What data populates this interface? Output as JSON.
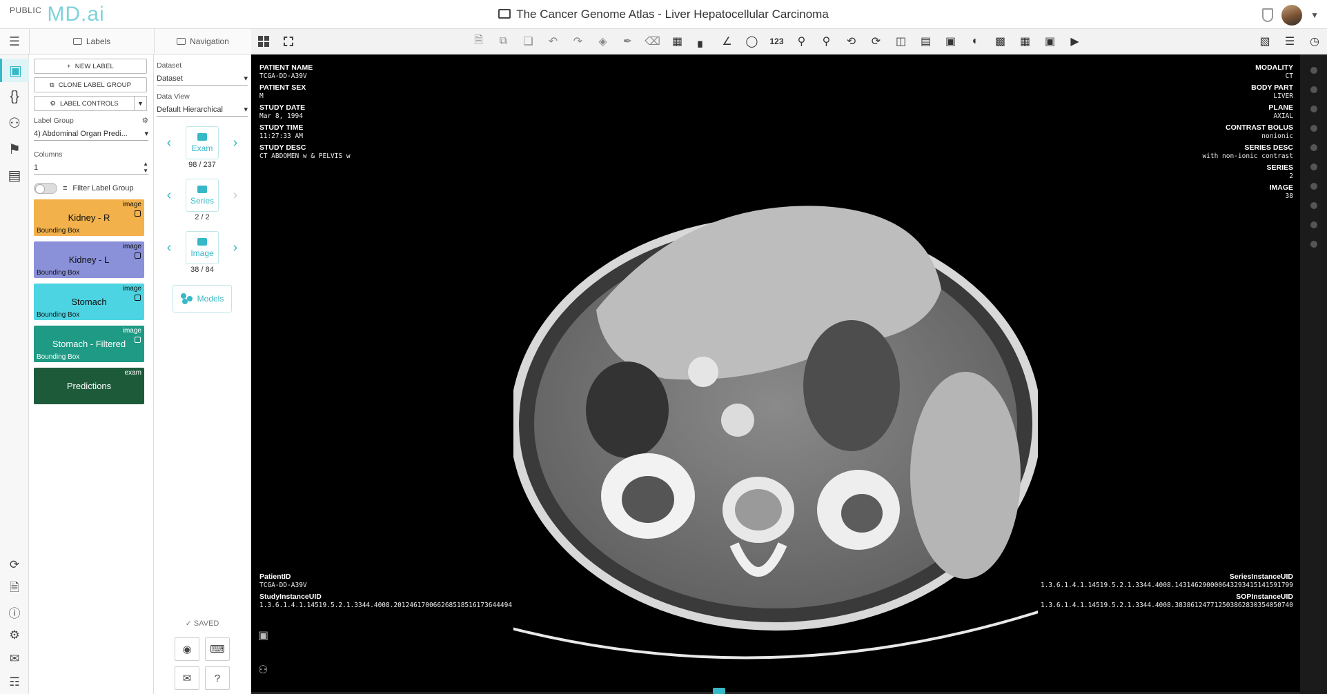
{
  "header": {
    "brand_prefix": "PUBLIC",
    "brand_logo": "MD.ai",
    "title": "The Cancer Genome Atlas - Liver Hepatocellular Carcinoma"
  },
  "tabs": {
    "labels": "Labels",
    "navigation": "Navigation"
  },
  "toolbar": {
    "count_tool_label": "123",
    "tools": [
      "layout-grid-icon",
      "fullscreen-icon",
      "new-study-icon",
      "copy-icon",
      "duplicate-icon",
      "undo-icon",
      "redo-icon",
      "layers-fill-icon",
      "brush-icon",
      "eraser-icon",
      "grid-icon",
      "ruler-icon",
      "angle-icon",
      "lasso-icon",
      "count-icon",
      "zoom-out-icon",
      "zoom-in-icon",
      "rotate-left-icon",
      "rotate-right-icon",
      "flip-h-icon",
      "flip-v-icon",
      "roi-icon",
      "contrast-icon",
      "window-level-icon",
      "invert-icon",
      "image-icon",
      "play-icon",
      "screenshot-icon",
      "stack-icon",
      "history-icon"
    ]
  },
  "labels_panel": {
    "new_label": "NEW LABEL",
    "clone_group": "CLONE LABEL GROUP",
    "label_controls": "LABEL CONTROLS",
    "label_group_caption": "Label Group",
    "label_group_value": "4) Abdominal Organ Predi...",
    "columns_caption": "Columns",
    "columns_value": "1",
    "filter_label": "Filter Label Group",
    "labels": [
      {
        "name": "Kidney - R",
        "scope": "image",
        "type": "Bounding Box",
        "color": "#f2b14a"
      },
      {
        "name": "Kidney - L",
        "scope": "image",
        "type": "Bounding Box",
        "color": "#8a91d9"
      },
      {
        "name": "Stomach",
        "scope": "image",
        "type": "Bounding Box",
        "color": "#4dd4e2"
      },
      {
        "name": "Stomach - Filtered",
        "scope": "image",
        "type": "Bounding Box",
        "color": "#1f9a84"
      },
      {
        "name": "Predictions",
        "scope": "exam",
        "type": "",
        "color": "#1d5a3a"
      }
    ]
  },
  "nav_panel": {
    "dataset_caption": "Dataset",
    "dataset_value": "Dataset",
    "dataview_caption": "Data View",
    "dataview_value": "Default Hierarchical",
    "exam_label": "Exam",
    "exam_count": "98 / 237",
    "series_label": "Series",
    "series_count": "2 / 2",
    "image_label": "Image",
    "image_count": "38 / 84",
    "models_label": "Models",
    "saved": "SAVED"
  },
  "overlay": {
    "top_left": [
      {
        "k": "PATIENT NAME",
        "v": "TCGA-DD-A39V"
      },
      {
        "k": "PATIENT SEX",
        "v": "M"
      },
      {
        "k": "STUDY DATE",
        "v": "Mar 8, 1994"
      },
      {
        "k": "STUDY TIME",
        "v": "11:27:33 AM"
      },
      {
        "k": "STUDY DESC",
        "v": "CT ABDOMEN w & PELVIS w"
      }
    ],
    "top_right": [
      {
        "k": "MODALITY",
        "v": "CT"
      },
      {
        "k": "BODY PART",
        "v": "LIVER"
      },
      {
        "k": "PLANE",
        "v": "AXIAL"
      },
      {
        "k": "CONTRAST BOLUS",
        "v": "nonionic"
      },
      {
        "k": "SERIES DESC",
        "v": "with non-ionic contrast"
      },
      {
        "k": "SERIES",
        "v": "2"
      },
      {
        "k": "IMAGE",
        "v": "38"
      }
    ],
    "bottom_left": [
      {
        "k": "PatientID",
        "v": "TCGA-DD-A39V"
      },
      {
        "k": "StudyInstanceUID",
        "v": "1.3.6.1.4.1.14519.5.2.1.3344.4008.201246170066268518516173644494"
      }
    ],
    "bottom_right": [
      {
        "k": "SeriesInstanceUID",
        "v": "1.3.6.1.4.1.14519.5.2.1.3344.4008.143146290000643293415141591799"
      },
      {
        "k": "SOPInstanceUID",
        "v": "1.3.6.1.4.1.14519.5.2.1.3344.4008.383861247712503862830354050740"
      }
    ]
  },
  "image_progress": 0.44
}
